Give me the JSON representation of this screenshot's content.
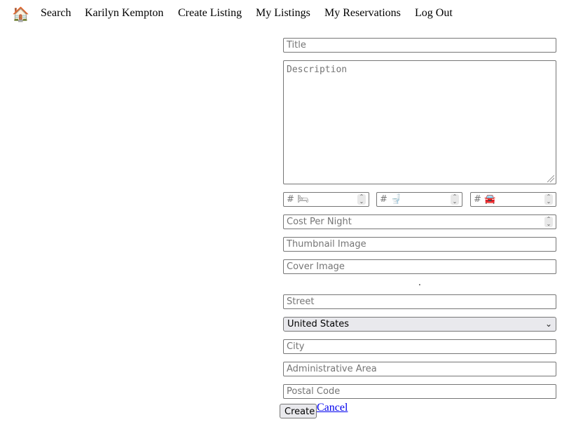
{
  "nav": {
    "home_icon": "🏠",
    "search": "Search",
    "user": "Karilyn Kempton",
    "create": "Create Listing",
    "listings": "My Listings",
    "reservations": "My Reservations",
    "logout": "Log Out"
  },
  "form": {
    "title_placeholder": "Title",
    "description_placeholder": "Description",
    "bedrooms_placeholder": "# 🛏",
    "bathrooms_placeholder": "# 🚽",
    "parking_placeholder": "# 🚘",
    "cost_placeholder": "Cost Per Night",
    "thumbnail_placeholder": "Thumbnail Image",
    "cover_placeholder": "Cover Image",
    "separator_dot": ".",
    "street_placeholder": "Street",
    "country_selected": "United States",
    "city_placeholder": "City",
    "admin_area_placeholder": "Administrative Area",
    "postal_placeholder": "Postal Code",
    "create_label": "Create",
    "cancel_label": "Cancel"
  }
}
